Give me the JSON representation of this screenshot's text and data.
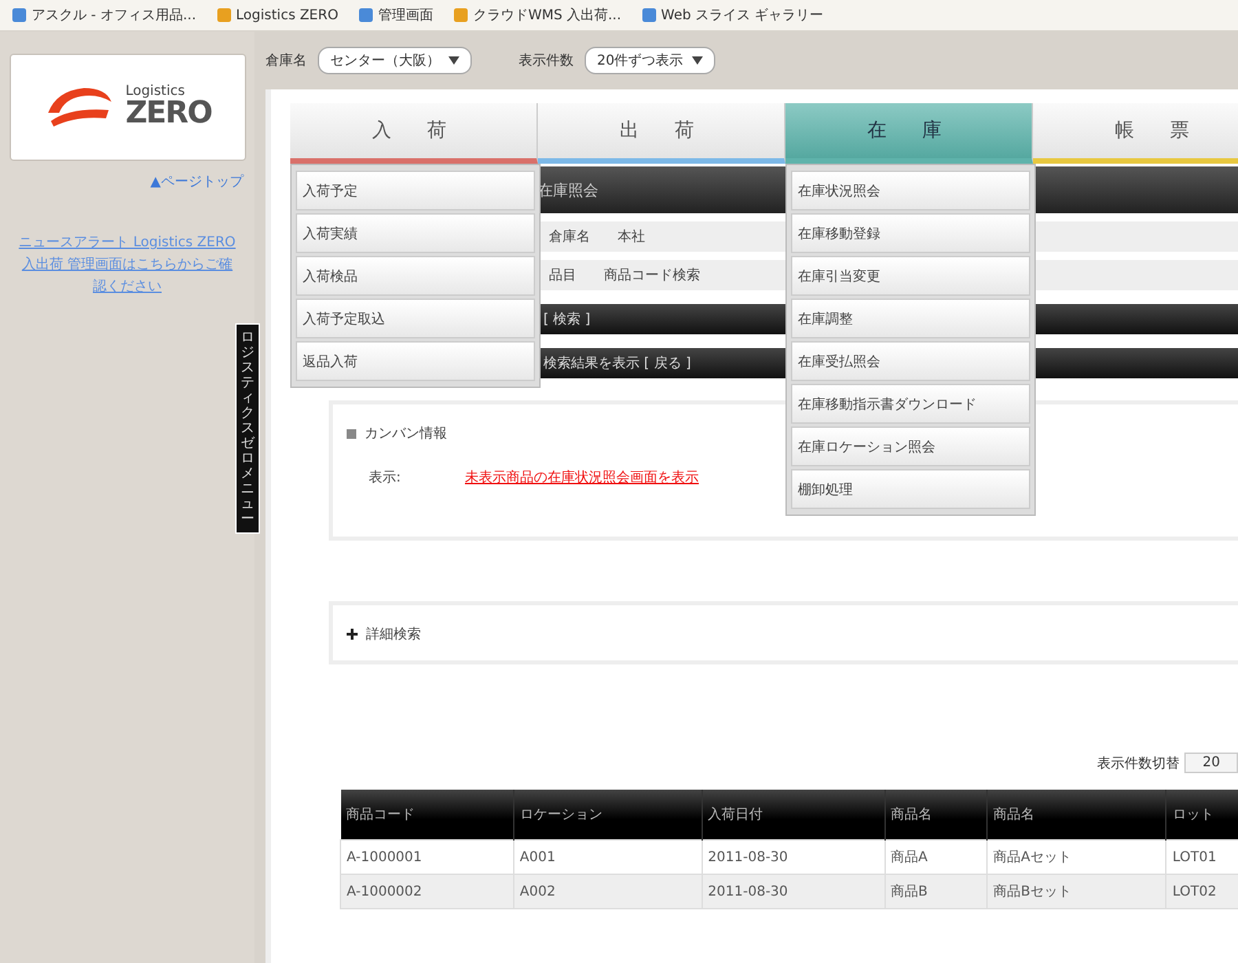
{
  "bookmarks": [
    {
      "label": "アスクル - オフィス用品..."
    },
    {
      "label": "Logistics ZERO"
    },
    {
      "label": "管理画面"
    },
    {
      "label": "クラウドWMS 入出荷..."
    },
    {
      "label": "Web スライス ギャラリー"
    }
  ],
  "logo": {
    "line_1": "Logistics",
    "line_2": "ZERO"
  },
  "sidebar": {
    "top_link": "▲ページトップ",
    "notice": "ニュースアラート Logistics ZERO 入出荷 管理画面はこちらからご確認ください",
    "vertical_tab": "ロジスティクスゼロメニュー"
  },
  "toolbar": {
    "warehouse_label": "倉庫名",
    "warehouse_value": "センター（大阪）",
    "count_label": "表示件数",
    "count_value": "20件ずつ表示"
  },
  "tabs": [
    {
      "label": "入　荷",
      "selected": false,
      "color": "#d9706a",
      "menu": [
        "入荷予定",
        "入荷実績",
        "入荷検品",
        "入荷予定取込",
        "返品入荷"
      ]
    },
    {
      "label": "出　荷",
      "selected": false,
      "color": "#7db9e8"
    },
    {
      "label": "在　庫",
      "selected": true,
      "color": "#5fb3ab",
      "menu": [
        "在庫状況照会",
        "在庫移動登録",
        "在庫引当変更",
        "在庫調整",
        "在庫受払照会",
        "在庫移動指示書ダウンロード",
        "在庫ロケーション照会",
        "棚卸処理"
      ]
    },
    {
      "label": "帳　票",
      "selected": false,
      "color": "#e8c840"
    }
  ],
  "page_header": "在庫照会",
  "form_rows": [
    {
      "label": "倉庫名",
      "value": "本社"
    },
    {
      "label": "品目",
      "value": "商品コード検索"
    }
  ],
  "dark_bars": [
    "[ 検索 ]",
    "検索結果を表示 [ 戻る ]"
  ],
  "kanban": {
    "title": "カンバン情報",
    "label": "表示:",
    "link": "未表示商品の在庫状況照会画面を表示"
  },
  "detail_search": {
    "title": "詳細検索"
  },
  "page_size": {
    "label": "表示件数切替",
    "value": "20"
  },
  "table": {
    "columns": [
      "商品コード",
      "ロケーション",
      "入荷日付",
      "商品名",
      "商品名",
      "ロット"
    ],
    "rows": [
      [
        "A-1000001",
        "A001",
        "2011-08-30",
        "商品A",
        "商品Aセット",
        "LOT01"
      ],
      [
        "A-1000002",
        "A002",
        "2011-08-30",
        "商品B",
        "商品Bセット",
        "LOT02"
      ]
    ]
  }
}
